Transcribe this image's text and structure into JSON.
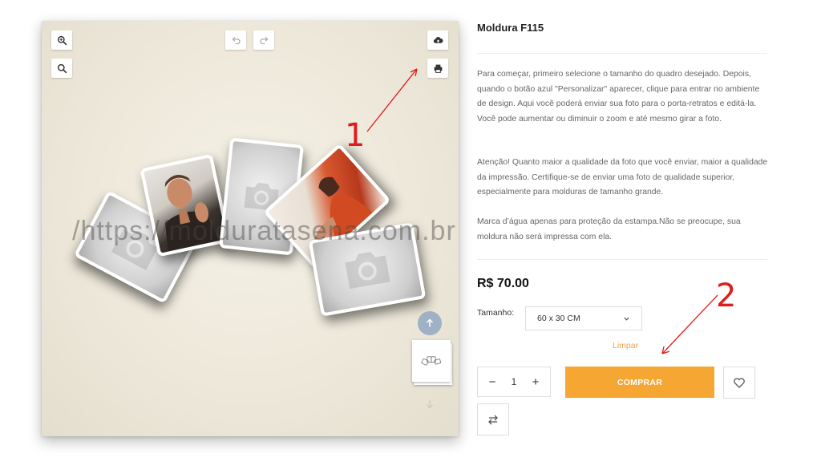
{
  "product": {
    "title": "Moldura F115",
    "description_1": "Para começar, primeiro selecione o tamanho do quadro desejado. Depois, quando o botão azul \"Personalizar\" aparecer, clique para entrar no ambiente de design. Aqui você poderá enviar sua foto para o porta-retratos e editá-la. Você pode aumentar ou diminuir o zoom e até mesmo girar a foto.",
    "description_2": "Atenção! Quanto maior a qualidade da foto que você enviar, maior a qualidade da impressão. Certifique-se de enviar uma foto de qualidade superior, especialmente para molduras de tamanho grande.",
    "description_3": "Marca d’água apenas para proteção da estampa.Não se preocupe, sua moldura não será impressa com ela.",
    "price": "R$ 70.00",
    "size_label": "Tamanho:",
    "size_value": "60 x 30 CM",
    "clear_label": "Limpar",
    "quantity": "1",
    "minus_symbol": "−",
    "plus_symbol": "+",
    "buy_label": "COMPRAR"
  },
  "canvas": {
    "watermark": "/https://molduratasena.com.br",
    "toolbar_icons": [
      "zoom-in-icon",
      "zoom-out-icon",
      "undo-icon",
      "redo-icon",
      "cloud-upload-icon",
      "print-icon"
    ],
    "photo_placeholder_icon": "camera-icon"
  },
  "annotations": {
    "one": "1",
    "two": "2"
  },
  "colors": {
    "buy_button": "#f6a632",
    "clear_link": "#f0a04a",
    "annotation": "#e01b1b",
    "scroll_up_button": "#9fb1c4"
  }
}
